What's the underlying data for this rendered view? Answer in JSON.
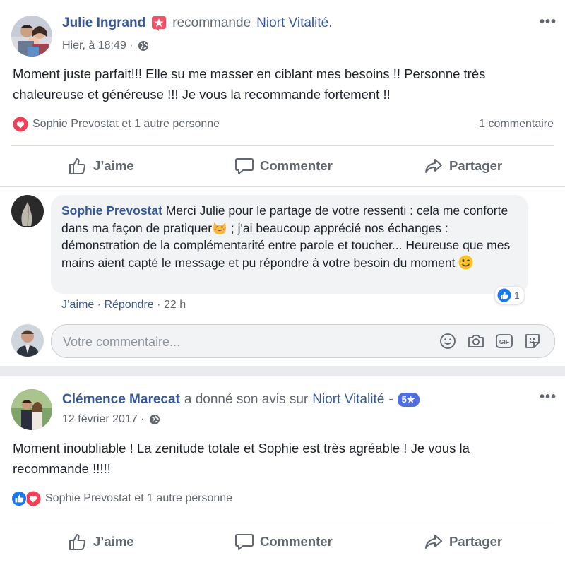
{
  "post1": {
    "author": "Julie Ingrand",
    "recommends_text": "recommande",
    "page_name": "Niort Vitalité.",
    "timestamp": "Hier, à 18:49 ·",
    "body_line1": "Moment juste parfait!!! Elle su me masser en ciblant mes besoins !! Personne très",
    "body_line2": "chaleureuse et généreuse !!! Je vous la recommande fortement !!",
    "reactions_text": "Sophie Prevostat et 1 autre personne",
    "comments_count": "1 commentaire",
    "actions": {
      "like": "J’aime",
      "comment": "Commenter",
      "share": "Partager"
    },
    "comment": {
      "author": "Sophie Prevostat",
      "text_part1": " Merci Julie pour le partage de votre ressenti : cela me conforte dans ma façon de pratiquer",
      "text_part2": " ; j'ai beaucoup apprécié nos échanges : démonstration de la complémentarité entre parole et toucher... Heureuse que mes mains aient capté le message et pu répondre à votre besoin du moment ",
      "like_count": "1",
      "like_action": "J’aime",
      "reply_action": "Répondre",
      "sep": " · ",
      "time": "22 h"
    },
    "comment_input_placeholder": "Votre commentaire..."
  },
  "post2": {
    "author": "Clémence Marecat",
    "review_text": "a donné son avis sur",
    "page_name": "Niort Vitalité",
    "dash": "-",
    "rating_badge": "5★",
    "timestamp": "12 février 2017 ·",
    "body_line1": "Moment inoubliable ! La zenitude totale et Sophie est très agréable ! Je vous la",
    "body_line2": "recommande !!!!!",
    "reactions_text": "Sophie Prevostat et 1 autre personne",
    "actions": {
      "like": "J’aime",
      "comment": "Commenter",
      "share": "Partager"
    }
  },
  "more_glyph": "•••",
  "colors": {
    "link": "#365899",
    "like_blue": "#1877f2",
    "love_red": "#f33e58",
    "recommend_red": "#f25268"
  }
}
